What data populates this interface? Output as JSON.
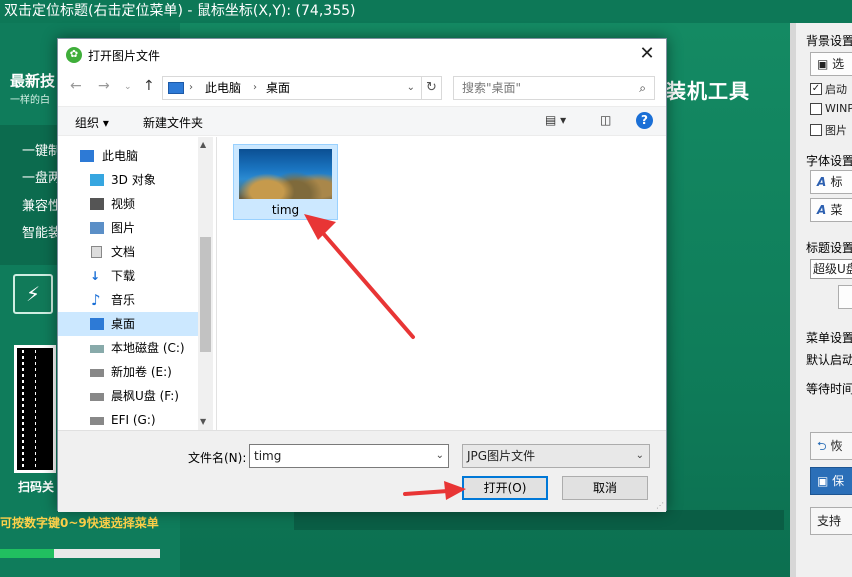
{
  "topbar": {
    "title": "双击定位标题(右击定位菜单) - 鼠标坐标(X,Y):    (74,355)"
  },
  "app": {
    "brand_title": "最新技",
    "brand_sub": "一样的白",
    "features": [
      "一键制",
      "一盘两",
      "兼容性",
      "智能装"
    ],
    "qr_label": "扫码关",
    "hint": "可按数字键0~9快速选择菜单",
    "brand_right": "装机工具",
    "progress_fraction": 0.34
  },
  "right_panel": {
    "bg_settings": "背景设置",
    "select_btn": "选",
    "check_startup": "启动",
    "check_winpe": "WINP",
    "check_image": "图片",
    "font_settings": "字体设置",
    "font_title_btn": "标",
    "font_menu_btn": "菜",
    "title_settings": "标题设置",
    "title_value": "超级U盘",
    "menu_settings": "菜单设置",
    "default_start": "默认启动",
    "wait_time": "等待时间",
    "restore_btn": "恢",
    "save_btn": "保",
    "support_btn": "支持"
  },
  "dialog": {
    "title": "打开图片文件",
    "address": {
      "crumbs": [
        "此电脑",
        "桌面"
      ]
    },
    "search_placeholder": "搜索\"桌面\"",
    "organize": "组织",
    "new_folder": "新建文件夹",
    "tree": [
      {
        "label": "此电脑",
        "icon": "computer-icon",
        "selected": false
      },
      {
        "label": "3D 对象",
        "icon": "cube-icon",
        "selected": false
      },
      {
        "label": "视频",
        "icon": "video-icon",
        "selected": false
      },
      {
        "label": "图片",
        "icon": "picture-icon",
        "selected": false
      },
      {
        "label": "文档",
        "icon": "document-icon",
        "selected": false
      },
      {
        "label": "下载",
        "icon": "download-icon",
        "selected": false
      },
      {
        "label": "音乐",
        "icon": "music-icon",
        "selected": false
      },
      {
        "label": "桌面",
        "icon": "desktop-icon",
        "selected": true
      },
      {
        "label": "本地磁盘 (C:)",
        "icon": "drive-icon",
        "selected": false
      },
      {
        "label": "新加卷 (E:)",
        "icon": "drive-icon",
        "selected": false
      },
      {
        "label": "晨枫U盘 (F:)",
        "icon": "drive-icon",
        "selected": false
      },
      {
        "label": "EFI (G:)",
        "icon": "drive-icon",
        "selected": false
      }
    ],
    "file": {
      "name": "timg"
    },
    "filename_label": "文件名(N):",
    "filename_value": "timg",
    "filetype": "JPG图片文件",
    "open_btn": "打开(O)",
    "cancel_btn": "取消"
  }
}
